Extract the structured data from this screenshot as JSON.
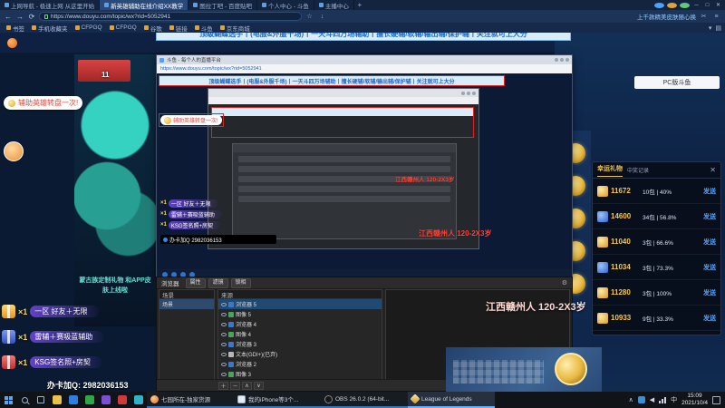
{
  "browser": {
    "tabs": [
      "上网导航 - 极速上网 从这里开始",
      "新英雄辅助在线介绍XX教学",
      "图拉丁吧 - 百度贴吧",
      "个人中心 - 斗鱼",
      "主播中心"
    ],
    "url": "https://www.douyu.com/topic/wx?rid=5052941",
    "promo": "上千款精美皮肤随心换",
    "bookmarks": [
      "书签",
      "手机收藏夹",
      "CFPGQ",
      "CFPGQ",
      "谷歌",
      "链接",
      "斗鱼",
      "京东商城"
    ]
  },
  "stream": {
    "banner": "顶级蝴蝶选手丨(电服&外服千场)丨一天斗四万场辅助丨擅长硬辅/软辅/输出辅/保护辅丨关注就可上大分",
    "bubble": "辅助英雄转盘一次!",
    "left_banner": "蒙古族定制礼物 和APP皮肤上线啦",
    "badge_count": "11",
    "pc_panel": "PC版斗鱼",
    "watermark": "江西赣州人 120-2X3岁",
    "qq_line": "办卡加Q: 2982036153"
  },
  "inner_window": {
    "title": "斗鱼 - 每个人的直播平台",
    "url": "https://www.douyu.com/topic/wx?rid=5052941",
    "banner": "顶级蝴蝶选手丨(电服&外服千场)丨一天斗四万场辅助丨擅长硬辅/软辅/输出辅/保护辅丨关注就可上大分",
    "bubble": "辅助英雄转盘一次!",
    "qq_bar": "办卡加Q 2982036153"
  },
  "obs": {
    "toolbar_label": "浏览器",
    "buttons": [
      "属性",
      "滤镜",
      "锁相"
    ],
    "scenes_title": "场景",
    "scene_item": "场景",
    "sources_title": "来源",
    "sources": [
      {
        "icon": "browser-source-icon",
        "label": "浏览器 5"
      },
      {
        "icon": "image-source-icon",
        "label": "图像 5"
      },
      {
        "icon": "browser-source-icon",
        "label": "浏览器 4"
      },
      {
        "icon": "image-source-icon",
        "label": "图像 4"
      },
      {
        "icon": "browser-source-icon",
        "label": "浏览器 3"
      },
      {
        "icon": "text-source-icon",
        "label": "文本(GDI+)(已弃)"
      },
      {
        "icon": "browser-source-icon",
        "label": "浏览器 2"
      },
      {
        "icon": "image-source-icon",
        "label": "图像 3"
      }
    ]
  },
  "gift_panel": {
    "tab_left": "幸运礼物",
    "tab_right": "中奖记录",
    "close": "✕",
    "rows": [
      {
        "points": "11672",
        "desc": "10包 | 40%",
        "action": "发送"
      },
      {
        "points": "14600",
        "desc": "34包 | 56.8%",
        "action": "发送"
      },
      {
        "points": "11040",
        "desc": "3包 | 66.6%",
        "action": "发送"
      },
      {
        "points": "11034",
        "desc": "3包 | 73.3%",
        "action": "发送"
      },
      {
        "points": "11280",
        "desc": "3包 | 100%",
        "action": "发送"
      },
      {
        "points": "10933",
        "desc": "9包 | 33.3%",
        "action": "发送"
      }
    ]
  },
  "chat": {
    "gifts": [
      {
        "count": "×1",
        "text": "一区 好友＋无限"
      },
      {
        "count": "×1",
        "text": "雷辅＋赛吸蓝辅助"
      },
      {
        "count": "×1",
        "text": "KSG签名照+房契"
      }
    ]
  },
  "taskbar": {
    "apps": [
      "七园所在-独家货源",
      "我的iPhone等3个...",
      "OBS 26.0.2 (64-bit...",
      "League of Legends"
    ],
    "lang": "中",
    "time": "15:09",
    "date": "2021/10/4"
  }
}
